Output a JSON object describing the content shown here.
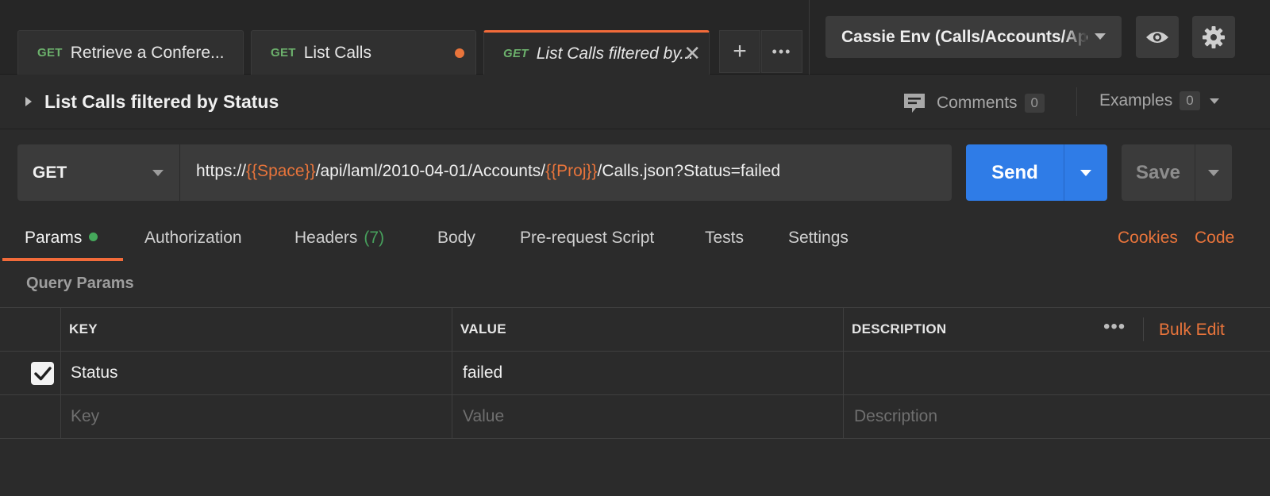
{
  "tabs": [
    {
      "method": "GET",
      "title": "Retrieve a Confere...",
      "state": "normal"
    },
    {
      "method": "GET",
      "title": "List Calls",
      "state": "unsaved"
    },
    {
      "method": "GET",
      "title": "List Calls filtered by...",
      "state": "active"
    }
  ],
  "tab_tools": {
    "add_icon": "plus-icon",
    "more_icon": "more-icon",
    "add_glyph": "+",
    "more_glyph": "•••",
    "close_glyph": "✕"
  },
  "environment": {
    "selected": "Cassie Env (Calls/Accounts/Ap",
    "eye_icon": "eye-icon",
    "settings_icon": "gear-icon"
  },
  "request": {
    "title": "List Calls filtered by Status",
    "comments_label": "Comments",
    "comments_count": "0",
    "examples_label": "Examples",
    "examples_count": "0"
  },
  "url_bar": {
    "method": "GET",
    "url_parts": [
      {
        "text": "https://",
        "is_var": false
      },
      {
        "text": "{{Space}}",
        "is_var": true
      },
      {
        "text": "/api/laml/2010-04-01/Accounts/",
        "is_var": false
      },
      {
        "text": "{{Proj}}",
        "is_var": true
      },
      {
        "text": "/Calls.json?Status=failed",
        "is_var": false
      }
    ],
    "send_label": "Send",
    "save_label": "Save"
  },
  "subtabs": {
    "params": "Params",
    "authorization": "Authorization",
    "headers": "Headers",
    "headers_count": "(7)",
    "body": "Body",
    "prerequest": "Pre-request Script",
    "tests": "Tests",
    "settings": "Settings",
    "cookies": "Cookies",
    "code": "Code"
  },
  "query_params": {
    "section_label": "Query Params",
    "columns": {
      "key": "KEY",
      "value": "VALUE",
      "description": "DESCRIPTION"
    },
    "more_glyph": "•••",
    "bulk_edit": "Bulk Edit",
    "rows": [
      {
        "checked": true,
        "key": "Status",
        "value": "failed",
        "description": ""
      }
    ],
    "placeholders": {
      "key": "Key",
      "value": "Value",
      "description": "Description"
    }
  },
  "colors": {
    "accent_orange": "#e8743b",
    "send_blue": "#2f7ce7",
    "method_green": "#6cb16c",
    "background": "#2b2b2b"
  }
}
